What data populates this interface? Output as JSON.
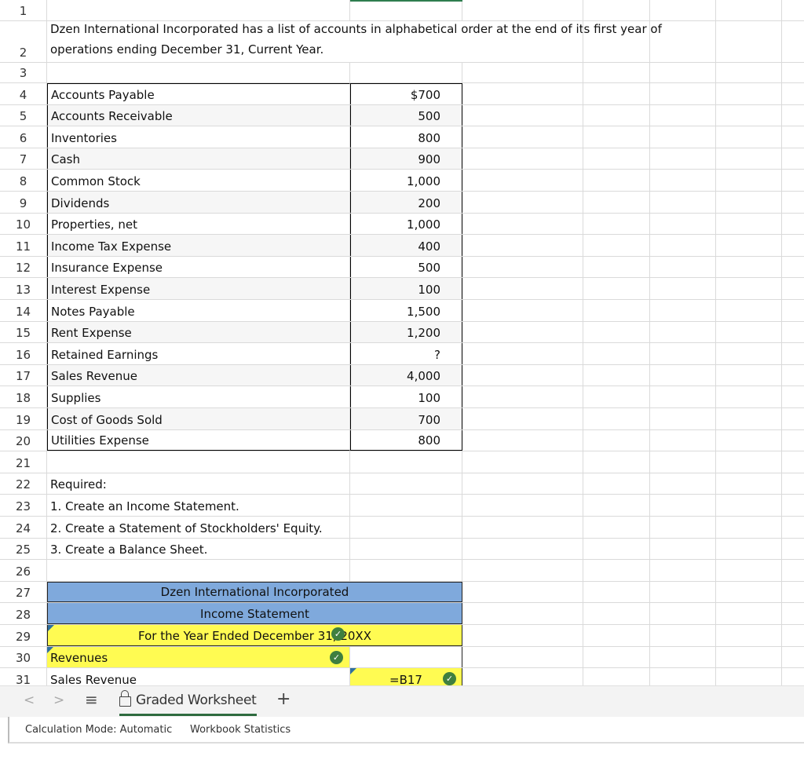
{
  "rows": [
    {
      "n": "1",
      "a": "",
      "b": ""
    },
    {
      "n": "2",
      "a": "Dzen International Incorporated has a list of accounts in alphabetical order at the end of its first year of",
      "a2": "operations ending December 31, Current Year.",
      "b": ""
    },
    {
      "n": "3",
      "a": "",
      "b": ""
    },
    {
      "n": "4",
      "a": "Accounts Payable",
      "b": "$700"
    },
    {
      "n": "5",
      "a": "Accounts Receivable",
      "b": "500"
    },
    {
      "n": "6",
      "a": "Inventories",
      "b": "800"
    },
    {
      "n": "7",
      "a": "Cash",
      "b": "900"
    },
    {
      "n": "8",
      "a": "Common Stock",
      "b": "1,000"
    },
    {
      "n": "9",
      "a": "Dividends",
      "b": "200"
    },
    {
      "n": "10",
      "a": "Properties, net",
      "b": "1,000"
    },
    {
      "n": "11",
      "a": "Income Tax Expense",
      "b": "400"
    },
    {
      "n": "12",
      "a": "Insurance Expense",
      "b": "500"
    },
    {
      "n": "13",
      "a": "Interest Expense",
      "b": "100"
    },
    {
      "n": "14",
      "a": "Notes Payable",
      "b": "1,500"
    },
    {
      "n": "15",
      "a": "Rent Expense",
      "b": "1,200"
    },
    {
      "n": "16",
      "a": "Retained Earnings",
      "b": "?"
    },
    {
      "n": "17",
      "a": "Sales Revenue",
      "b": "4,000"
    },
    {
      "n": "18",
      "a": "Supplies",
      "b": "100"
    },
    {
      "n": "19",
      "a": "Cost of Goods Sold",
      "b": "700"
    },
    {
      "n": "20",
      "a": "Utilities Expense",
      "b": "800"
    },
    {
      "n": "21",
      "a": "",
      "b": ""
    },
    {
      "n": "22",
      "a": "Required:",
      "b": ""
    },
    {
      "n": "23",
      "a": "1. Create an Income Statement.",
      "b": ""
    },
    {
      "n": "24",
      "a": "2. Create a Statement of Stockholders' Equity.",
      "b": ""
    },
    {
      "n": "25",
      "a": "3. Create a Balance Sheet.",
      "b": ""
    },
    {
      "n": "26",
      "a": "",
      "b": ""
    },
    {
      "n": "27",
      "a": "Dzen International Incorporated",
      "b": ""
    },
    {
      "n": "28",
      "a": "Income Statement",
      "b": ""
    },
    {
      "n": "29",
      "a": "For the Year Ended December 31, 20XX",
      "b": ""
    },
    {
      "n": "30",
      "a": "Revenues",
      "b": ""
    },
    {
      "n": "31",
      "a": "Sales Revenue",
      "b": "=B17"
    }
  ],
  "colors": {
    "header_blue": "#7fa9dc",
    "answer_yellow": "#fffb52",
    "check_green": "#3f7f3f"
  },
  "tabs": {
    "prev": "<",
    "next": ">",
    "menu": "≡",
    "sheet": "Graded Worksheet",
    "add": "+"
  },
  "status": {
    "calc_mode": "Calculation Mode: Automatic",
    "stats": "Workbook Statistics"
  }
}
